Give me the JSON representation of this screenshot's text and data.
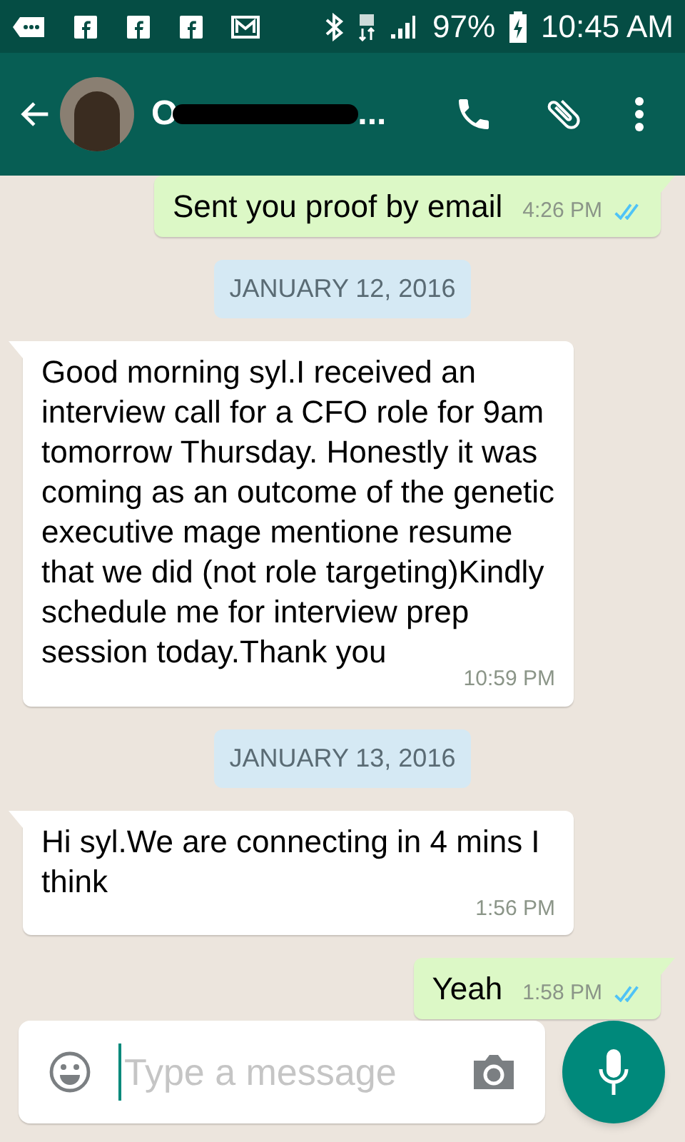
{
  "status_bar": {
    "battery": "97%",
    "time": "10:45 AM"
  },
  "header": {
    "name_start": "O",
    "name_end": "..."
  },
  "messages": [
    {
      "kind": "outgoing",
      "text": "Sent you proof by email",
      "time": "4:26 PM",
      "read": true
    },
    {
      "kind": "date",
      "text": "JANUARY 12, 2016"
    },
    {
      "kind": "incoming",
      "text": "Good morning syl.I received an interview call for a CFO role for 9am tomorrow Thursday. Honestly it was coming as an outcome of the genetic executive mage mentione resume that we did (not role targeting)Kindly schedule me for interview prep session today.Thank you",
      "time": "10:59 PM"
    },
    {
      "kind": "date",
      "text": "JANUARY 13, 2016"
    },
    {
      "kind": "incoming",
      "text": "Hi syl.We are connecting in 4 mins I think",
      "time": "1:56 PM"
    },
    {
      "kind": "outgoing",
      "text": "Yeah",
      "time": "1:58 PM",
      "read": true
    }
  ],
  "composer": {
    "placeholder": "Type a message"
  }
}
